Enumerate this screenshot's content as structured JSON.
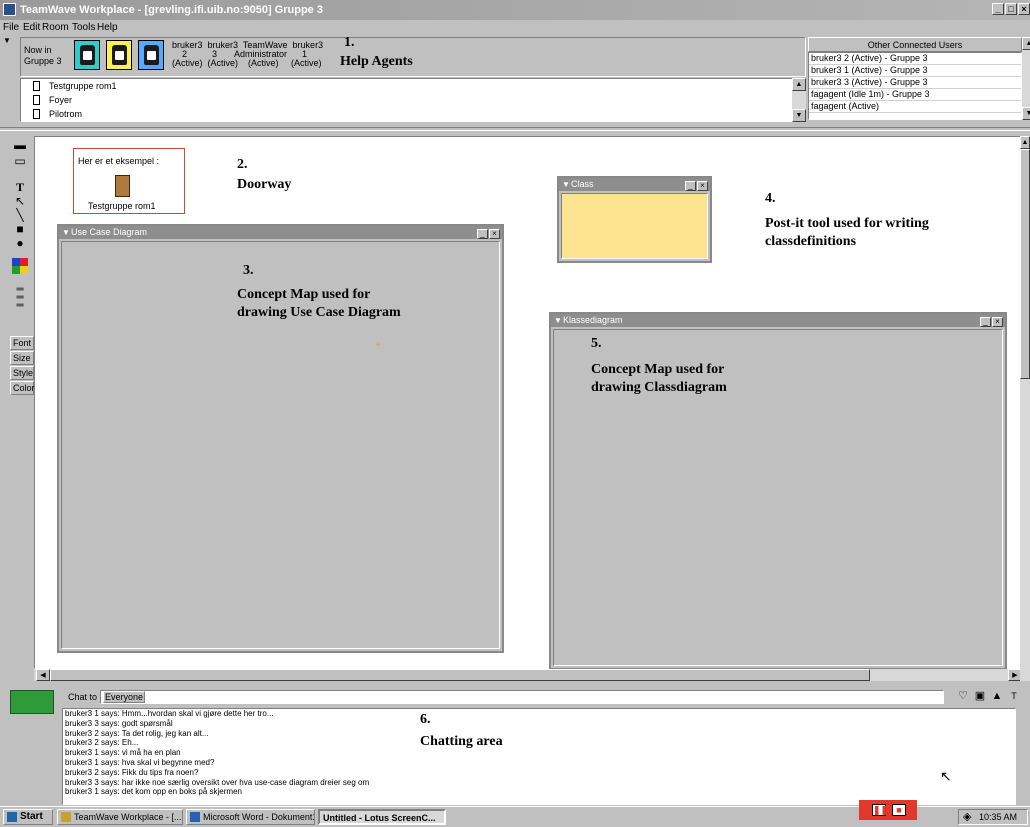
{
  "window": {
    "title": "TeamWave Workplace - [grevling.ifi.uib.no:9050] Gruppe 3",
    "controls": [
      "_",
      "□",
      "×"
    ]
  },
  "menu": [
    "File",
    "Edit",
    "Room",
    "Tools",
    "Help"
  ],
  "now_in": {
    "line1": "Now in",
    "line2": "Gruppe 3"
  },
  "agents": {
    "colors": [
      "#33cccc",
      "#ffee55",
      "#55aaff"
    ],
    "names": "bruker3  bruker3  TeamWave  bruker3",
    "ids": "    2          3       Administrator      1",
    "status": "(Active)  (Active)    (Active)     (Active)"
  },
  "annotations": {
    "a1_num": "1.",
    "a1_text": "Help Agents",
    "a2_num": "2.",
    "a2_text": "Doorway",
    "a3_num": "3.",
    "a3_line1": "Concept Map used for",
    "a3_line2": "drawing Use Case Diagram",
    "a4_num": "4.",
    "a4_line1": "Post-it tool used for writing",
    "a4_line2": "classdefinitions",
    "a5_num": "5.",
    "a5_line1": "Concept Map used for",
    "a5_line2": "drawing Classdiagram",
    "a6_num": "6.",
    "a6_text": "Chatting area"
  },
  "other_users": {
    "title": "Other Connected Users",
    "items": [
      "bruker3 2 (Active) - Gruppe 3",
      "bruker3 1 (Active) - Gruppe 3",
      "bruker3 3 (Active) - Gruppe 3",
      "fagagent (Idle 1m) - Gruppe 3",
      "fagagent (Active)"
    ]
  },
  "rooms": [
    "Testgruppe rom1",
    "Foyer",
    "Pilotrom"
  ],
  "toolbar": {
    "labels": [
      "Font",
      "Size",
      "Style",
      "Color"
    ],
    "palette": [
      "#1c3fd6",
      "#e02020",
      "#20a020",
      "#e8d020"
    ]
  },
  "doorway": {
    "title": "Her er et eksempel :",
    "label": "Testgruppe rom1"
  },
  "windows": {
    "use_case": "Use Case Diagram",
    "class": "Class",
    "klassediagram": "Klassediagram",
    "postit_color": "#fbe38f"
  },
  "chat": {
    "to_label": "Chat to",
    "to_value": "Everyone",
    "messages": [
      "bruker3 1 says: Hmm...hvordan skal vi gjøre dette her tro...",
      "bruker3 3 says: godt spørsmål",
      "bruker3 2 says: Ta det rolig, jeg kan alt...",
      "bruker3 2 says: Eh...",
      "bruker3 1 says: vi må ha en plan",
      "bruker3 1 says: hva skal vi begynne med?",
      "bruker3 2 says: Fikk du tips fra noen?",
      "bruker3 3 says: har ikke noe særlig oversikt over hva use-case diagram dreier seg om",
      "bruker3 1 says: det kom opp en boks på skjermen"
    ]
  },
  "taskbar": {
    "start": "Start",
    "tasks": [
      "TeamWave Workplace - [...",
      "Microsoft Word - Dokument1",
      "Untitled - Lotus ScreenC..."
    ],
    "clock": "10:35 AM"
  }
}
